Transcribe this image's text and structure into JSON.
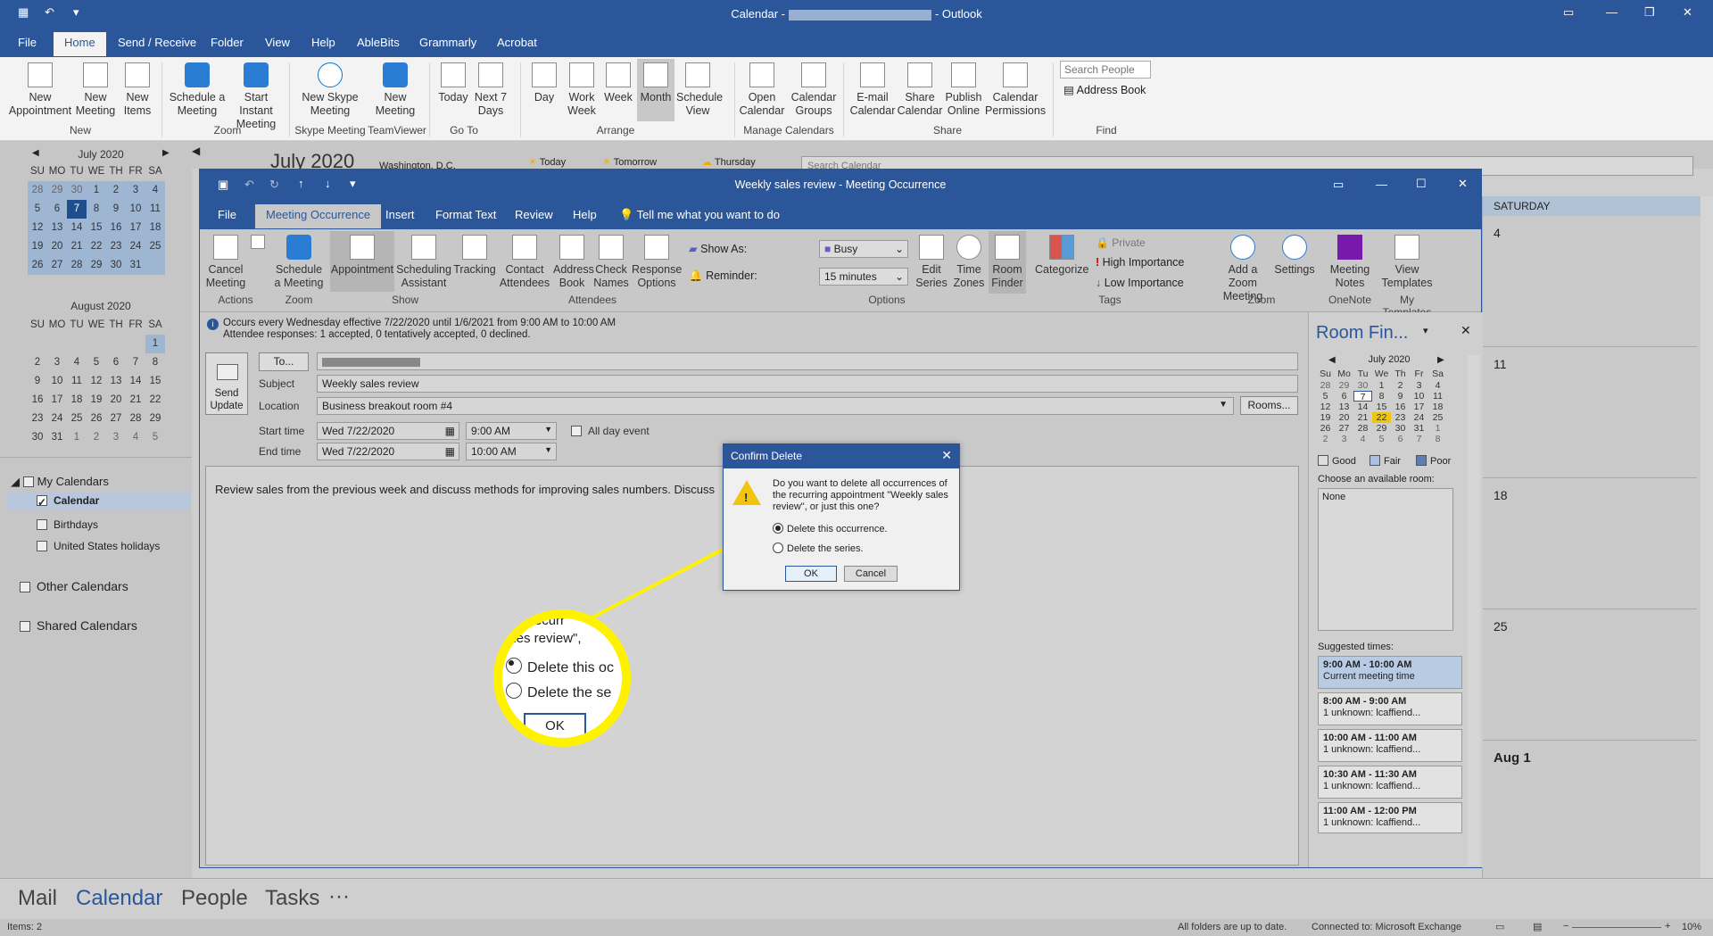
{
  "window": {
    "title_prefix": "Calendar -",
    "title_suffix": "- Outlook"
  },
  "menu_tabs": [
    "File",
    "Home",
    "Send / Receive",
    "Folder",
    "View",
    "Help",
    "AbleBits",
    "Grammarly",
    "Acrobat"
  ],
  "ribbon": {
    "new_appointment": "New Appointment",
    "new_meeting": "New Meeting",
    "new_items": "New Items",
    "schedule_meeting": "Schedule a Meeting",
    "start_instant_meeting": "Start Instant Meeting",
    "new_skype_meeting": "New Skype Meeting",
    "teamviewer_new_meeting": "New Meeting",
    "today": "Today",
    "next_7_days": "Next 7 Days",
    "day": "Day",
    "work_week": "Work Week",
    "week": "Week",
    "month": "Month",
    "schedule_view": "Schedule View",
    "open_calendar": "Open Calendar",
    "calendar_groups": "Calendar Groups",
    "email_calendar": "E-mail Calendar",
    "share_calendar": "Share Calendar",
    "publish_online": "Publish Online",
    "calendar_permissions": "Calendar Permissions",
    "search_people_placeholder": "Search People",
    "address_book": "Address Book",
    "groups": {
      "new": "New",
      "zoom": "Zoom",
      "skype": "Skype Meeting",
      "teamviewer": "TeamViewer",
      "goto": "Go To",
      "arrange": "Arrange",
      "manage": "Manage Calendars",
      "share": "Share",
      "find": "Find"
    }
  },
  "leftnav": {
    "july": {
      "title": "July 2020",
      "headers": [
        "SU",
        "MO",
        "TU",
        "WE",
        "TH",
        "FR",
        "SA"
      ],
      "days": [
        "28",
        "29",
        "30",
        "1",
        "2",
        "3",
        "4",
        "5",
        "6",
        "7",
        "8",
        "9",
        "10",
        "11",
        "12",
        "13",
        "14",
        "15",
        "16",
        "17",
        "18",
        "19",
        "20",
        "21",
        "22",
        "23",
        "24",
        "25",
        "26",
        "27",
        "28",
        "29",
        "30",
        "31",
        ""
      ]
    },
    "august": {
      "title": "August 2020",
      "headers": [
        "SU",
        "MO",
        "TU",
        "WE",
        "TH",
        "FR",
        "SA"
      ],
      "days": [
        "",
        "",
        "",
        "",
        "",
        "",
        "1",
        "2",
        "3",
        "4",
        "5",
        "6",
        "7",
        "8",
        "9",
        "10",
        "11",
        "12",
        "13",
        "14",
        "15",
        "16",
        "17",
        "18",
        "19",
        "20",
        "21",
        "22",
        "23",
        "24",
        "25",
        "26",
        "27",
        "28",
        "29",
        "30",
        "31",
        "1",
        "2",
        "3",
        "4",
        "5"
      ]
    },
    "my_calendars": "My Calendars",
    "calendar": "Calendar",
    "birthdays": "Birthdays",
    "us_holidays": "United States holidays",
    "other_calendars": "Other Calendars",
    "shared_calendars": "Shared Calendars"
  },
  "behind": {
    "month_label": "July 2020",
    "location": "Washington, D.C.",
    "today": "Today",
    "tomorrow": "Tomorrow",
    "thursday": "Thursday",
    "search_calendar": "Search Calendar"
  },
  "meeting": {
    "title": "Weekly sales review - Meeting Occurrence",
    "tabs": [
      "File",
      "Meeting Occurrence",
      "Insert",
      "Format Text",
      "Review",
      "Help"
    ],
    "tell_me": "Tell me what you want to do",
    "ribbon": {
      "cancel_meeting": "Cancel Meeting",
      "schedule_meeting": "Schedule a Meeting",
      "appointment": "Appointment",
      "scheduling_assistant": "Scheduling Assistant",
      "tracking": "Tracking",
      "contact_attendees": "Contact Attendees",
      "address_book": "Address Book",
      "check_names": "Check Names",
      "response_options": "Response Options",
      "show_as": "Show As:",
      "show_as_value": "Busy",
      "reminder": "Reminder:",
      "reminder_value": "15 minutes",
      "edit_series": "Edit Series",
      "time_zones": "Time Zones",
      "room_finder": "Room Finder",
      "categorize": "Categorize",
      "private": "Private",
      "high_importance": "High Importance",
      "low_importance": "Low Importance",
      "add_zoom_meeting": "Add a Zoom Meeting",
      "settings": "Settings",
      "meeting_notes": "Meeting Notes",
      "view_templates": "View Templates",
      "groups": {
        "actions": "Actions",
        "zoom1": "Zoom",
        "show": "Show",
        "attendees": "Attendees",
        "options": "Options",
        "tags": "Tags",
        "zoom2": "Zoom",
        "onenote": "OneNote",
        "my_templates": "My Templates"
      }
    },
    "info_line1": "Occurs every Wednesday effective 7/22/2020 until 1/6/2021 from 9:00 AM to 10:00 AM",
    "info_line2": "Attendee responses: 1 accepted, 0 tentatively accepted, 0 declined.",
    "send_update": "Send Update",
    "to_button": "To...",
    "subject_label": "Subject",
    "subject": "Weekly sales review",
    "location_label": "Location",
    "location": "Business breakout room #4",
    "rooms_button": "Rooms...",
    "start_label": "Start time",
    "start_date": "Wed 7/22/2020",
    "start_time": "9:00 AM",
    "end_label": "End time",
    "end_date": "Wed 7/22/2020",
    "end_time": "10:00 AM",
    "all_day": "All day event",
    "body": "Review sales from the previous week and discuss methods for improving sales numbers. Discuss"
  },
  "roomfinder": {
    "title": "Room Fin...",
    "month": "July 2020",
    "headers": [
      "Su",
      "Mo",
      "Tu",
      "We",
      "Th",
      "Fr",
      "Sa"
    ],
    "days": [
      "28",
      "29",
      "30",
      "1",
      "2",
      "3",
      "4",
      "5",
      "6",
      "7",
      "8",
      "9",
      "10",
      "11",
      "12",
      "13",
      "14",
      "15",
      "16",
      "17",
      "18",
      "19",
      "20",
      "21",
      "22",
      "23",
      "24",
      "25",
      "26",
      "27",
      "28",
      "29",
      "30",
      "31",
      "1",
      "2",
      "3",
      "4",
      "5",
      "6",
      "7",
      "8"
    ],
    "good": "Good",
    "fair": "Fair",
    "poor": "Poor",
    "choose_room": "Choose an available room:",
    "room_none": "None",
    "suggested": "Suggested times:",
    "suggestions": [
      {
        "time": "9:00 AM - 10:00 AM",
        "note": "Current meeting time"
      },
      {
        "time": "8:00 AM - 9:00 AM",
        "note": "1 unknown: lcaffiend..."
      },
      {
        "time": "10:00 AM - 11:00 AM",
        "note": "1 unknown: lcaffiend..."
      },
      {
        "time": "10:30 AM - 11:30 AM",
        "note": "1 unknown: lcaffiend..."
      },
      {
        "time": "11:00 AM - 12:00 PM",
        "note": "1 unknown: lcaffiend..."
      }
    ]
  },
  "dialog": {
    "title": "Confirm Delete",
    "message": "Do you want to delete all occurrences of the recurring appointment \"Weekly sales review\", or just this one?",
    "option1": "Delete this occurrence.",
    "option2": "Delete the series.",
    "ok": "OK",
    "cancel": "Cancel"
  },
  "magnifier": {
    "line1": "he recurr",
    "line2": "ales review\",",
    "option1": "Delete this oc",
    "option2": "Delete the se",
    "ok": "OK"
  },
  "weekcal": {
    "header": "SATURDAY",
    "days": [
      "4",
      "11",
      "18",
      "25",
      "Aug 1"
    ]
  },
  "bottomnav": {
    "mail": "Mail",
    "calendar": "Calendar",
    "people": "People",
    "tasks": "Tasks",
    "more": "···"
  },
  "status": {
    "items": "Items: 2",
    "uptodate": "All folders are up to date.",
    "connected": "Connected to: Microsoft Exchange",
    "zoom": "10%"
  },
  "colors": {
    "accent": "#2b579a",
    "highlight": "#fff200"
  }
}
